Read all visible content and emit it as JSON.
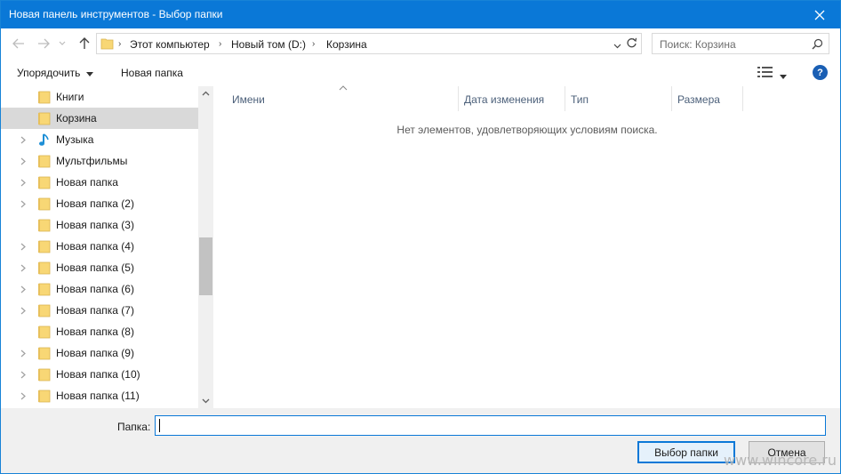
{
  "window": {
    "title": "Новая панель инструментов - Выбор папки"
  },
  "nav": {
    "breadcrumbs": [
      {
        "label": "Этот компьютер"
      },
      {
        "label": "Новый том (D:)"
      },
      {
        "label": "Корзина"
      }
    ],
    "search_placeholder": "Поиск: Корзина"
  },
  "commands": {
    "organize": "Упорядочить",
    "new_folder": "Новая папка",
    "help": "?"
  },
  "tree": {
    "items": [
      {
        "label": "Книги",
        "expandable": false,
        "selected": false,
        "icon": "folder-icon"
      },
      {
        "label": "Корзина",
        "expandable": false,
        "selected": true,
        "icon": "folder-icon"
      },
      {
        "label": "Музыка",
        "expandable": true,
        "selected": false,
        "icon": "music-icon"
      },
      {
        "label": "Мультфильмы",
        "expandable": true,
        "selected": false,
        "icon": "folder-icon"
      },
      {
        "label": "Новая папка",
        "expandable": true,
        "selected": false,
        "icon": "folder-icon"
      },
      {
        "label": "Новая папка (2)",
        "expandable": true,
        "selected": false,
        "icon": "folder-icon"
      },
      {
        "label": "Новая папка (3)",
        "expandable": false,
        "selected": false,
        "icon": "folder-icon"
      },
      {
        "label": "Новая папка (4)",
        "expandable": true,
        "selected": false,
        "icon": "folder-icon"
      },
      {
        "label": "Новая папка (5)",
        "expandable": true,
        "selected": false,
        "icon": "folder-icon"
      },
      {
        "label": "Новая папка (6)",
        "expandable": true,
        "selected": false,
        "icon": "folder-icon"
      },
      {
        "label": "Новая папка (7)",
        "expandable": true,
        "selected": false,
        "icon": "folder-icon"
      },
      {
        "label": "Новая папка (8)",
        "expandable": false,
        "selected": false,
        "icon": "folder-icon"
      },
      {
        "label": "Новая папка (9)",
        "expandable": true,
        "selected": false,
        "icon": "folder-icon"
      },
      {
        "label": "Новая папка (10)",
        "expandable": true,
        "selected": false,
        "icon": "folder-icon"
      },
      {
        "label": "Новая папка (11)",
        "expandable": true,
        "selected": false,
        "icon": "folder-icon"
      }
    ]
  },
  "content": {
    "columns": [
      {
        "label": "Имени"
      },
      {
        "label": "Дата изменения"
      },
      {
        "label": "Тип"
      },
      {
        "label": "Размера"
      }
    ],
    "empty_message": "Нет элементов, удовлетворяющих условиям поиска."
  },
  "footer": {
    "folder_label": "Папка:",
    "folder_value": "",
    "select_button": "Выбор папки",
    "cancel_button": "Отмена",
    "watermark": "www.wincore.ru"
  },
  "colors": {
    "accent": "#0a78d7",
    "folder": "#f8d775"
  }
}
